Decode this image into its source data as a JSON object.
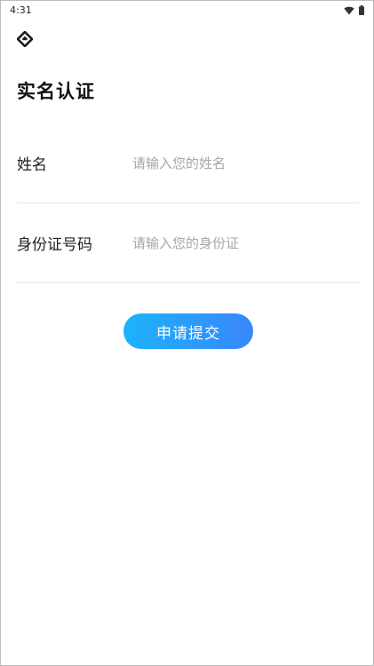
{
  "status_bar": {
    "time": "4:31",
    "icons": [
      "wifi-icon",
      "battery-icon"
    ]
  },
  "header": {
    "back_icon": "back-diamond-icon",
    "title": "实名认证"
  },
  "form": {
    "name": {
      "label": "姓名",
      "value": "",
      "placeholder": "请输入您的姓名"
    },
    "id_number": {
      "label": "身份证号码",
      "value": "",
      "placeholder": "请输入您的身份证"
    }
  },
  "submit": {
    "label": "申请提交"
  },
  "colors": {
    "accent_start": "#1cb3fb",
    "accent_end": "#3a86fb",
    "divider": "#e6e6e6",
    "placeholder": "#a6a6a6"
  }
}
